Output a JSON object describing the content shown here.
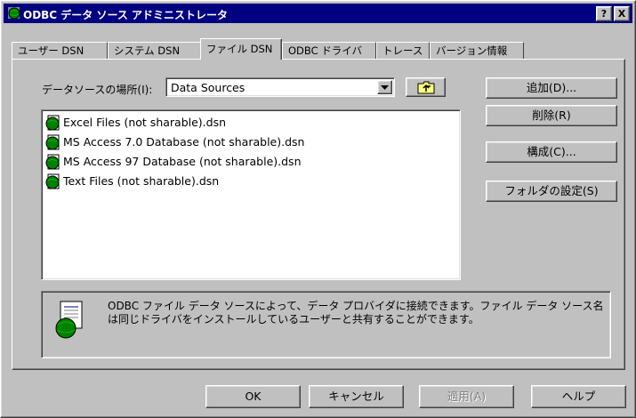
{
  "window": {
    "title": "ODBC データ ソース アドミニストレータ",
    "help_button": "?",
    "close_button": "X"
  },
  "tabs": [
    {
      "label": "ユーザー DSN",
      "active": false
    },
    {
      "label": "システム DSN",
      "active": false
    },
    {
      "label": "ファイル DSN",
      "active": true
    },
    {
      "label": "ODBC ドライバ",
      "active": false
    },
    {
      "label": "トレース",
      "active": false
    },
    {
      "label": "バージョン情報",
      "active": false
    }
  ],
  "location": {
    "label": "データソースの場所(I):",
    "value": "Data Sources"
  },
  "files": [
    "Excel Files (not sharable).dsn",
    "MS Access 7.0 Database (not sharable).dsn",
    "MS Access 97 Database (not sharable).dsn",
    "Text Files (not sharable).dsn"
  ],
  "actions": {
    "add": "追加(D)...",
    "remove": "削除(R)",
    "configure": "構成(C)...",
    "set_folder": "フォルダの設定(S)"
  },
  "info": {
    "text": "ODBC ファイル データ ソースによって、データ プロバイダに接続できます。ファイル データ ソース名は同じドライバをインストールしているユーザーと共有することができます。"
  },
  "buttons": {
    "ok": "OK",
    "cancel": "キャンセル",
    "apply": "適用(A)",
    "help": "ヘルプ"
  },
  "colors": {
    "titlebar": "#000080",
    "face": "#c0c0c0",
    "disabled_text": "#808080"
  }
}
